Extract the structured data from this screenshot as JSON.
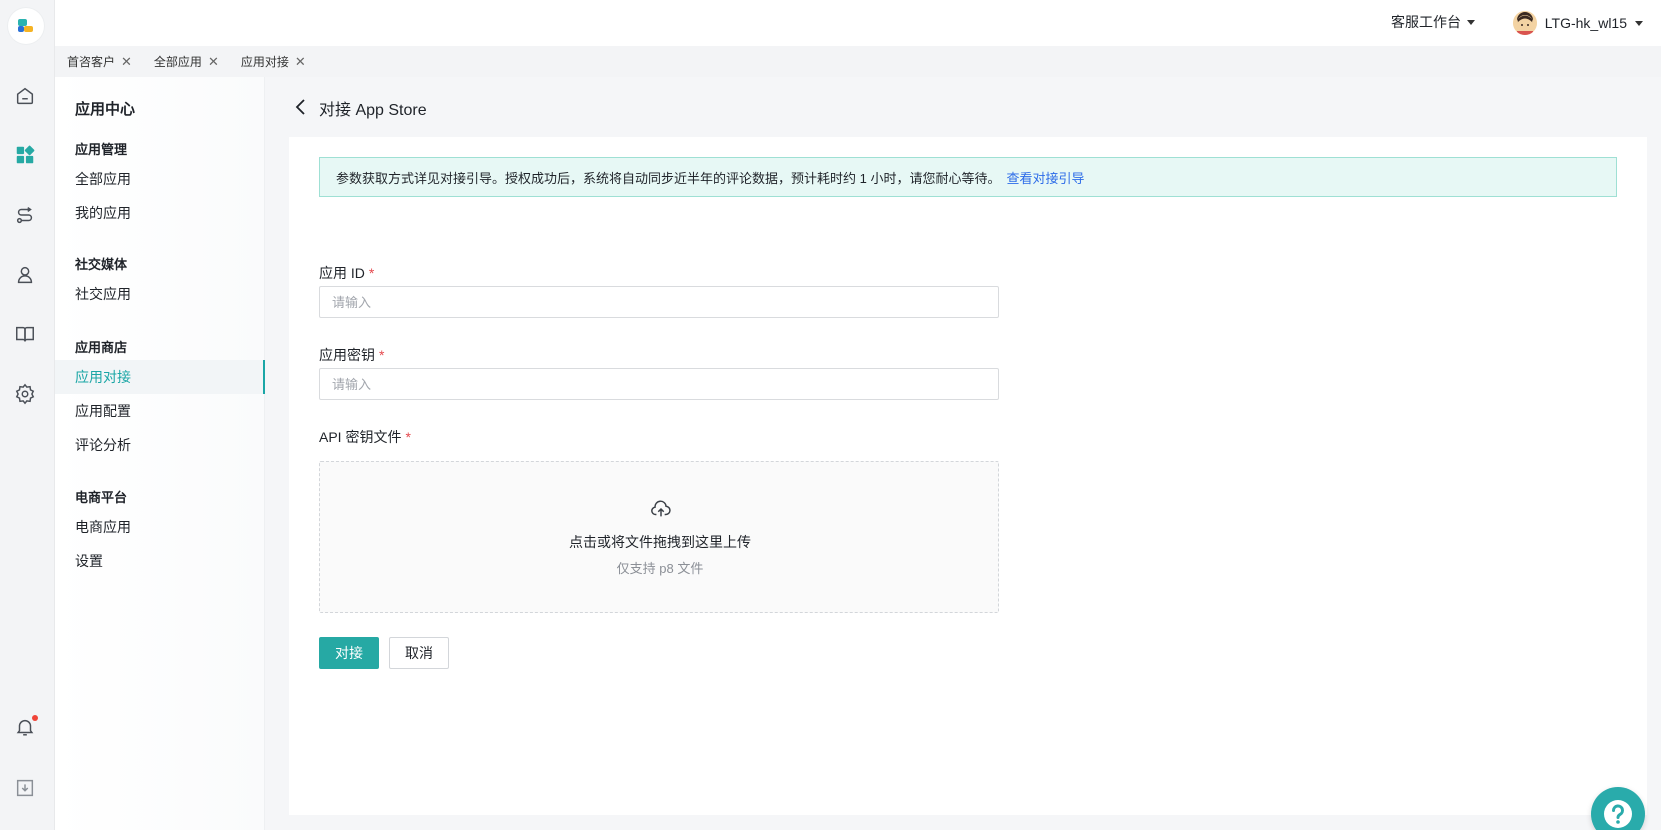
{
  "topbar": {
    "workspace_label": "客服工作台",
    "user_name": "LTG-hk_wl15"
  },
  "tabs": [
    {
      "label": "首咨客户"
    },
    {
      "label": "全部应用"
    },
    {
      "label": "应用对接"
    }
  ],
  "sidebar": {
    "title": "应用中心",
    "groups": [
      {
        "label": "应用管理",
        "items": [
          "全部应用",
          "我的应用"
        ]
      },
      {
        "label": "社交媒体",
        "items": [
          "社交应用"
        ]
      },
      {
        "label": "应用商店",
        "items": [
          "应用对接",
          "应用配置",
          "评论分析"
        ]
      },
      {
        "label": "电商平台",
        "items": [
          "电商应用",
          "设置"
        ]
      }
    ],
    "active_item": "应用对接"
  },
  "page": {
    "title": "对接 App Store",
    "alert_text": "参数获取方式详见对接引导。授权成功后，系统将自动同步近半年的评论数据，预计耗时约 1 小时，请您耐心等待。",
    "alert_link": "查看对接引导"
  },
  "form": {
    "app_id_label": "应用 ID",
    "app_id_placeholder": "请输入",
    "app_id_value": "",
    "app_secret_label": "应用密钥",
    "app_secret_placeholder": "请输入",
    "app_secret_value": "",
    "api_file_label": "API 密钥文件",
    "required_mark": "*",
    "upload_text": "点击或将文件拖拽到这里上传",
    "upload_hint": "仅支持 p8 文件",
    "submit_label": "对接",
    "cancel_label": "取消"
  },
  "colors": {
    "accent": "#26a9a4",
    "link": "#2c6be8",
    "required": "#e5484d",
    "notification_dot": "#f04438"
  },
  "icons": {
    "rail": [
      "home-icon",
      "apps-icon",
      "route-icon",
      "user-icon",
      "book-icon",
      "settings-icon",
      "bell-icon",
      "download-icon"
    ],
    "help": "question-icon",
    "upload": "cloud-upload-icon"
  }
}
